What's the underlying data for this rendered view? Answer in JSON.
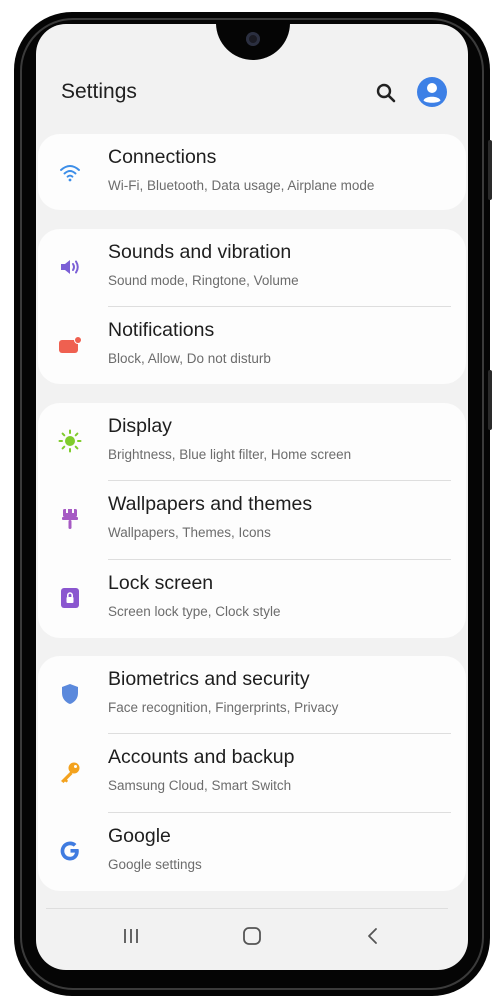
{
  "header": {
    "title": "Settings"
  },
  "groups": [
    {
      "items": [
        {
          "title": "Connections",
          "subtitle": "Wi-Fi, Bluetooth, Data usage, Airplane mode",
          "icon": "wifi-icon",
          "color": "#3d8ee8"
        }
      ]
    },
    {
      "items": [
        {
          "title": "Sounds and vibration",
          "subtitle": "Sound mode, Ringtone, Volume",
          "icon": "volume-icon",
          "color": "#7b5fd6"
        },
        {
          "title": "Notifications",
          "subtitle": "Block, Allow, Do not disturb",
          "icon": "notification-icon",
          "color": "#ef6050"
        }
      ]
    },
    {
      "items": [
        {
          "title": "Display",
          "subtitle": "Brightness, Blue light filter, Home screen",
          "icon": "sun-icon",
          "color": "#7fcc2c"
        },
        {
          "title": "Wallpapers and themes",
          "subtitle": "Wallpapers, Themes, Icons",
          "icon": "brush-icon",
          "color": "#a65ac4"
        },
        {
          "title": "Lock screen",
          "subtitle": "Screen lock type, Clock style",
          "icon": "lock-icon",
          "color": "#8a56cf"
        }
      ]
    },
    {
      "items": [
        {
          "title": "Biometrics and security",
          "subtitle": "Face recognition, Fingerprints, Privacy",
          "icon": "shield-icon",
          "color": "#5b89dc"
        },
        {
          "title": "Accounts and backup",
          "subtitle": "Samsung Cloud, Smart Switch",
          "icon": "key-icon",
          "color": "#f3a21e"
        },
        {
          "title": "Google",
          "subtitle": "Google settings",
          "icon": "google-icon",
          "color": "#3f7be0"
        }
      ]
    }
  ],
  "navbar": {
    "recents_icon": "recents-icon",
    "home_icon": "home-icon",
    "back_icon": "back-icon"
  }
}
